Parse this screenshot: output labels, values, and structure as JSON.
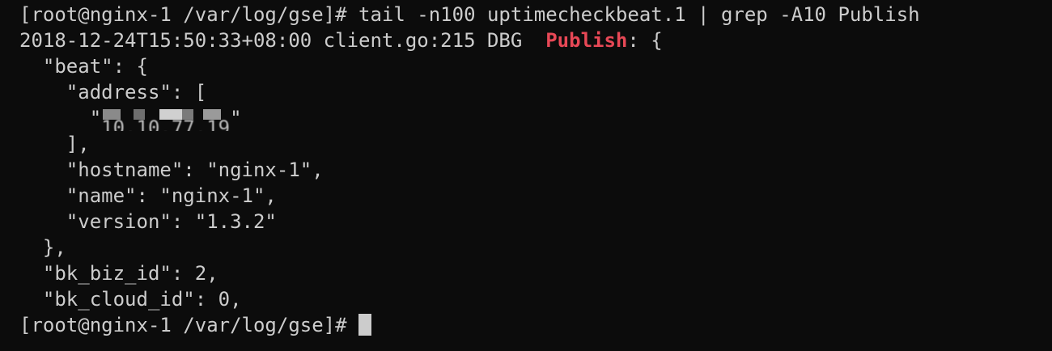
{
  "terminal": {
    "command_line": {
      "prompt": "[root@nginx-1 /var/log/gse]# ",
      "command": "tail -n100 uptimecheckbeat.1 | grep -A10 Publish"
    },
    "log_line": {
      "prefix": "2018-12-24T15:50:33+08:00 client.go:215 DBG  ",
      "match": "Publish",
      "suffix": ": {"
    },
    "json_lines": [
      "  \"beat\": {",
      "    \"address\": [",
      "      \"",
      "    ],",
      "    \"hostname\": \"nginx-1\",",
      "    \"name\": \"nginx-1\",",
      "    \"version\": \"1.3.2\"",
      "  },",
      "  \"bk_biz_id\": 2,",
      "  \"bk_cloud_id\": 0,"
    ],
    "redacted_address": {
      "visible_fragment": "10.10.77.19",
      "closing_quote": "\""
    },
    "final_prompt": "[root@nginx-1 /var/log/gse]# "
  },
  "colors": {
    "background": "#0c0c0c",
    "foreground": "#cccccc",
    "highlight": "#e74856"
  }
}
